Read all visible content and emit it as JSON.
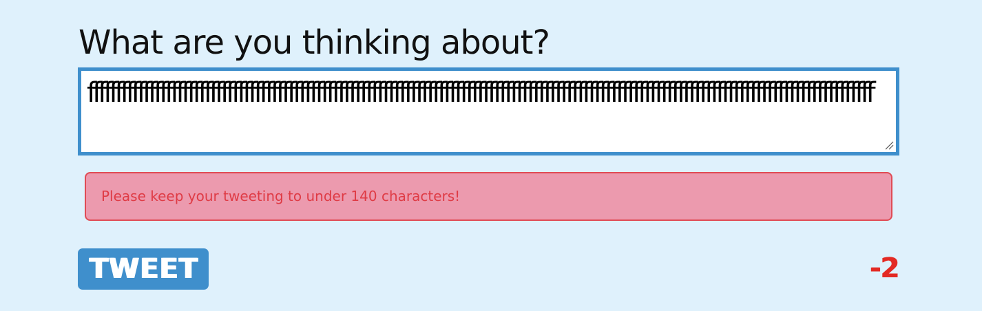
{
  "prompt": {
    "question": "What are you thinking about?"
  },
  "composer": {
    "text": "fffffffffffffffffffffffffffffffffffffffffffffffffffffffffffffffffffffffffffffffffffffffffffffffffffffffffffffffffffffffffffffffffffffffffffff",
    "error_message": "Please keep your tweeting to under 140 characters!",
    "tweet_button_label": "TWEET",
    "remaining_characters": "-2"
  },
  "colors": {
    "background": "#dff1fc",
    "accent": "#3f8fcc",
    "error_background": "#ec9aae",
    "error_text": "#df3b45",
    "counter_negative": "#e32a24"
  },
  "icons": {
    "resize_handle": "resize-handle-icon"
  }
}
